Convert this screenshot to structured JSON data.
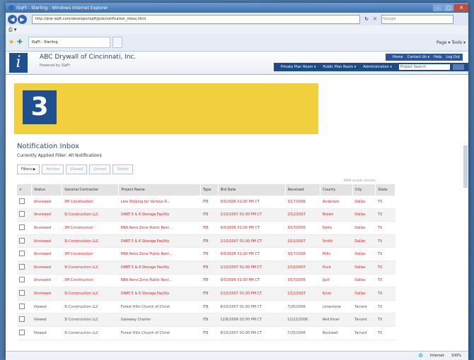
{
  "browser": {
    "title": "iSqFt - Sterling - Windows Internet Explorer",
    "url": "http://drw-isqft.com/develops/isqft/pub/notification_inbox.html",
    "search_placeholder": "Google",
    "tab_label": "iSqFt - Sterling",
    "command_bar": "Page ▾ Tools ▾"
  },
  "app": {
    "company": "ABC Drywall of Cincinnati, Inc.",
    "powered_by": "Powered by iSqFt",
    "top_links": [
      "Home",
      "Contact Us ▾",
      "Help",
      "Log Out"
    ],
    "nav": [
      "Private Plan Room ▾",
      "Public Plan Room ▾",
      "Administration ▾"
    ],
    "project_search": "Project Search"
  },
  "step": {
    "number": "3"
  },
  "inbox": {
    "title": "Notification Inbox",
    "filter_text": "Currently Applied Filter: All Notifications",
    "toolbar": [
      "Filters ▶",
      "Archive",
      "Viewed",
      "Unread",
      "Delete"
    ],
    "filter_note": "9999 records selected",
    "columns": [
      "Status",
      "General Contractor",
      "Project Name",
      "Type",
      "Bid Date",
      "Received",
      "County",
      "City",
      "State"
    ],
    "rows": [
      {
        "status": "Unviewed",
        "gc": "3M Construction",
        "project": "Line Striping for Various R...",
        "type": "ITB",
        "bid": "9/5/2006 01:00 PM CT",
        "received": "3/17/2006",
        "county": "Anderson",
        "city": "Dallas",
        "state": "TX",
        "state_class": "unread"
      },
      {
        "status": "Unviewed",
        "gc": "3i Construction LLC",
        "project": "DART 5 & 6 Storage Facility",
        "type": "ITB",
        "bid": "2/10/2007 01:00 PM CT",
        "received": "2/12/2007",
        "county": "Brown",
        "city": "Dallas",
        "state": "TX",
        "state_class": "unread"
      },
      {
        "status": "Unviewed",
        "gc": "3M Construction",
        "project": "RBA Reno Zone Public Rest...",
        "type": "ITB",
        "bid": "9/5/2006 01:00 PM CT",
        "received": "3/17/2006",
        "county": "Delta",
        "city": "Dallas",
        "state": "TX",
        "state_class": "unread"
      },
      {
        "status": "Unviewed",
        "gc": "3i Construction LLC",
        "project": "DART 5 & 6 Storage Facility",
        "type": "ITB",
        "bid": "2/10/2007 01:00 PM CT",
        "received": "2/12/2007",
        "county": "Smith",
        "city": "Dallas",
        "state": "TX",
        "state_class": "unread"
      },
      {
        "status": "Unviewed",
        "gc": "3M Construction",
        "project": "RBA Reno Zone Public Rest...",
        "type": "ITB",
        "bid": "9/5/2006 01:00 PM CT",
        "received": "3/17/2006",
        "county": "Mills",
        "city": "Dallas",
        "state": "TX",
        "state_class": "unread"
      },
      {
        "status": "Unviewed",
        "gc": "3i Construction LLC",
        "project": "DART 5 & 6 Storage Facility",
        "type": "ITB",
        "bid": "2/10/2007 01:00 PM CT",
        "received": "2/12/2007",
        "county": "Hunt",
        "city": "Dallas",
        "state": "TX",
        "state_class": "unread"
      },
      {
        "status": "Unviewed",
        "gc": "3M Construction",
        "project": "RBA Reno Zone Public Rest...",
        "type": "ITB",
        "bid": "9/5/2006 01:00 PM CT",
        "received": "3/17/2006",
        "county": "Jack",
        "city": "Dallas",
        "state": "TX",
        "state_class": "unread"
      },
      {
        "status": "Unviewed",
        "gc": "3i Construction LLC",
        "project": "DART 5 & 6 Storage Facility",
        "type": "ITB",
        "bid": "2/10/2007 01:00 PM CT",
        "received": "2/12/2007",
        "county": "Knox",
        "city": "Dallas",
        "state": "TX",
        "state_class": "unread"
      },
      {
        "status": "Viewed",
        "gc": "3i Construction LLC",
        "project": "Forest Hills Church of Christ",
        "type": "ITB",
        "bid": "8/15/2007 01:00 PM CT",
        "received": "7/25/2006",
        "county": "Limestone",
        "city": "Tarrant",
        "state": "TX",
        "state_class": "viewed"
      },
      {
        "status": "Viewed",
        "gc": "3i Construction LLC",
        "project": "Gateway Charter",
        "type": "ITB",
        "bid": "12/6/2006 02:00 PM CT",
        "received": "11/22/2006",
        "county": "Red River",
        "city": "Tarrant",
        "state": "TX",
        "state_class": "viewed"
      },
      {
        "status": "Viewed",
        "gc": "3i Construction LLC",
        "project": "Forest Hills Church of Christ",
        "type": "ITB",
        "bid": "8/15/2007 01:00 PM CT",
        "received": "7/25/2006",
        "county": "Rockwall",
        "city": "Tarrant",
        "state": "TX",
        "state_class": "viewed"
      }
    ]
  },
  "status_bar": {
    "zone": "Internet",
    "zoom": "100%"
  }
}
